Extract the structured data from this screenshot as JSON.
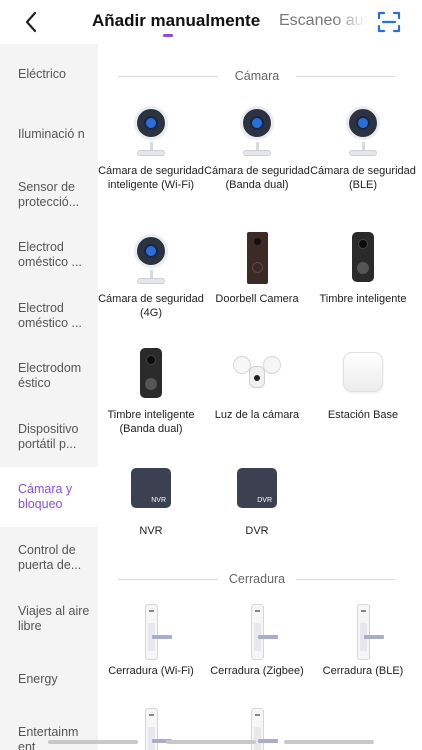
{
  "header": {
    "tab_manual": "Añadir manualmente",
    "tab_scan": "Escaneo automático"
  },
  "sidebar": {
    "items": [
      {
        "label": "Eléctrico"
      },
      {
        "label": "Iluminació n"
      },
      {
        "label": "Sensor de protecció..."
      },
      {
        "label": "Electrod oméstico ..."
      },
      {
        "label": "Electrod oméstico ..."
      },
      {
        "label": "Electrodom éstico"
      },
      {
        "label": "Dispositivo portátil p..."
      },
      {
        "label": "Cámara y bloqueo",
        "selected": true
      },
      {
        "label": "Control de puerta de..."
      },
      {
        "label": "Viajes al aire libre"
      },
      {
        "label": "Energy"
      },
      {
        "label": "Entertainm ent"
      }
    ],
    "selected_color": "#8a4fd8"
  },
  "sections": {
    "camera": {
      "title": "Cámara",
      "items": [
        {
          "label": "Cámara de seguridad inteligente (Wi-Fi)"
        },
        {
          "label": "Cámara de seguridad (Banda dual)"
        },
        {
          "label": "Cámara de seguridad (BLE)"
        },
        {
          "label": "Cámara de seguridad (4G)"
        },
        {
          "label": "Doorbell Camera"
        },
        {
          "label": "Timbre inteligente"
        },
        {
          "label": "Timbre inteligente (Banda dual)"
        },
        {
          "label": "Luz de la cámara"
        },
        {
          "label": "Estación Base"
        },
        {
          "label": "NVR",
          "badge": "NVR"
        },
        {
          "label": "DVR",
          "badge": "DVR"
        }
      ]
    },
    "lock": {
      "title": "Cerradura",
      "items": [
        {
          "label": "Cerradura (Wi-Fi)"
        },
        {
          "label": "Cerradura (Zigbee)"
        },
        {
          "label": "Cerradura (BLE)"
        }
      ]
    }
  }
}
